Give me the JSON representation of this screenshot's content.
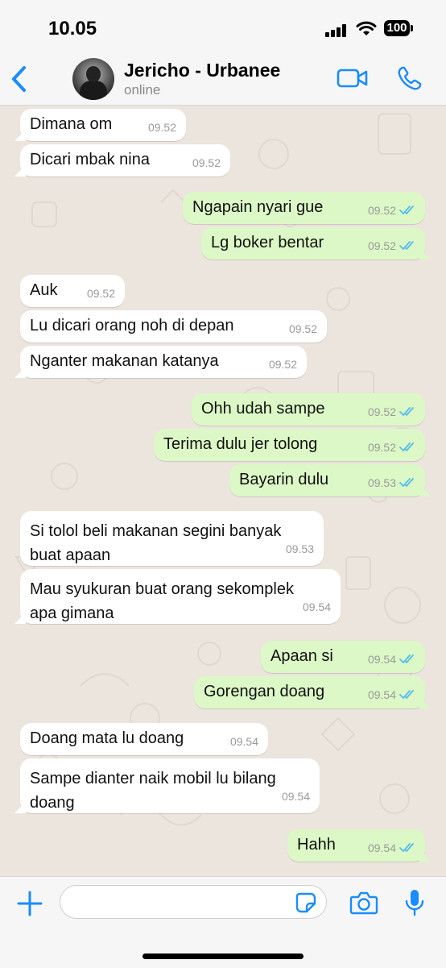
{
  "status_bar": {
    "time": "10.05",
    "battery": "100"
  },
  "header": {
    "name": "Jericho - Urbanee",
    "status": "online"
  },
  "colors": {
    "accent": "#1a8cff",
    "incoming": "#ffffff",
    "outgoing": "#dcf8c6",
    "chat_bg": "#ece5dd",
    "tick_read": "#53bdeb"
  },
  "messages": [
    {
      "dir": "in",
      "text": "Dimana om",
      "time": "09.52"
    },
    {
      "dir": "in",
      "text": "Dicari mbak nina",
      "time": "09.52"
    },
    {
      "dir": "out",
      "text": "Ngapain nyari gue",
      "time": "09.52",
      "status": "read"
    },
    {
      "dir": "out",
      "text": "Lg boker bentar",
      "time": "09.52",
      "status": "read"
    },
    {
      "dir": "in",
      "text": "Auk",
      "time": "09.52"
    },
    {
      "dir": "in",
      "text": "Lu dicari orang noh di depan",
      "time": "09.52"
    },
    {
      "dir": "in",
      "text": "Nganter makanan katanya",
      "time": "09.52"
    },
    {
      "dir": "out",
      "text": "Ohh udah sampe",
      "time": "09.52",
      "status": "read"
    },
    {
      "dir": "out",
      "text": "Terima dulu jer tolong",
      "time": "09.52",
      "status": "read"
    },
    {
      "dir": "out",
      "text": "Bayarin dulu",
      "time": "09.53",
      "status": "read"
    },
    {
      "dir": "in",
      "text": "Si tolol beli makanan segini banyak\nbuat apaan",
      "time": "09.53"
    },
    {
      "dir": "in",
      "text": "Mau syukuran buat orang sekomplek\napa gimana",
      "time": "09.54"
    },
    {
      "dir": "out",
      "text": "Apaan si",
      "time": "09.54",
      "status": "read"
    },
    {
      "dir": "out",
      "text": "Gorengan doang",
      "time": "09.54",
      "status": "read"
    },
    {
      "dir": "in",
      "text": "Doang mata lu doang",
      "time": "09.54"
    },
    {
      "dir": "in",
      "text": "Sampe dianter naik mobil lu bilang\ndoang",
      "time": "09.54"
    },
    {
      "dir": "out",
      "text": "Hahh",
      "time": "09.54",
      "status": "read"
    }
  ],
  "composer": {
    "value": "",
    "placeholder": ""
  },
  "icons": {
    "back": "chevron-left-icon",
    "video": "video-call-icon",
    "call": "phone-icon",
    "plus": "plus-icon",
    "sticker": "sticker-icon",
    "camera": "camera-icon",
    "mic": "microphone-icon"
  }
}
